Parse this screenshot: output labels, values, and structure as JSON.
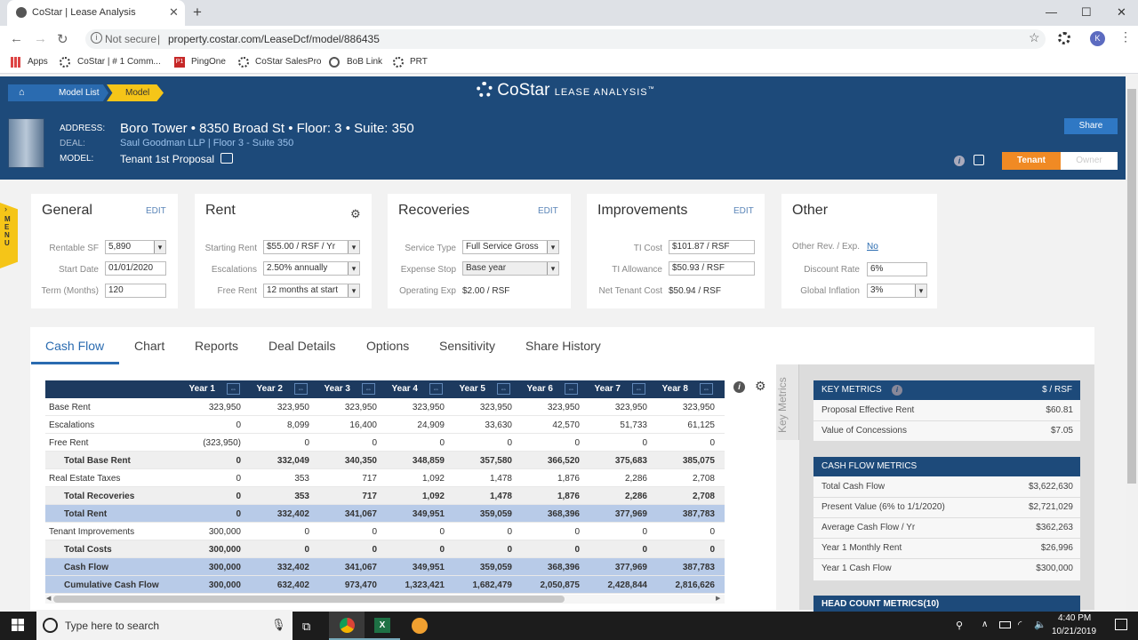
{
  "browser": {
    "tab_title": "CoStar | Lease Analysis",
    "tab_close": "✕",
    "new_tab": "+",
    "win_min": "—",
    "win_max": "☐",
    "win_close": "✕",
    "not_secure": "Not secure",
    "separator": "|",
    "url": "property.costar.com/LeaseDcf/model/886435",
    "profile_initial": "K",
    "bookmarks": [
      "Apps",
      "CoStar | # 1 Comm...",
      "PingOne",
      "CoStar SalesPro",
      "BoB Link",
      "PRT"
    ]
  },
  "app": {
    "breadcrumb": [
      "Model List",
      "Model"
    ],
    "logo_main": "CoStar",
    "logo_sub": "LEASE ANALYSIS",
    "logo_tm": "™",
    "address_label": "ADDRESS:",
    "address": "Boro Tower • 8350 Broad St • Floor: 3 • Suite: 350",
    "deal_label": "DEAL:",
    "deal": "Saul Goodman LLP | Floor 3 - Suite 350",
    "model_label": "MODEL:",
    "model": "Tenant 1st Proposal",
    "share": "Share",
    "tenant": "Tenant",
    "owner": "Owner"
  },
  "cards": {
    "general": {
      "title": "General",
      "edit": "EDIT",
      "rentable_sf_label": "Rentable SF",
      "rentable_sf": "5,890",
      "start_date_label": "Start Date",
      "start_date": "01/01/2020",
      "term_label": "Term (Months)",
      "term": "120"
    },
    "rent": {
      "title": "Rent",
      "starting_rent_label": "Starting Rent",
      "starting_rent": "$55.00 / RSF / Yr",
      "escalations_label": "Escalations",
      "escalations": "2.50% annually",
      "free_rent_label": "Free Rent",
      "free_rent": "12 months at start"
    },
    "recoveries": {
      "title": "Recoveries",
      "edit": "EDIT",
      "service_type_label": "Service Type",
      "service_type": "Full Service Gross",
      "expense_stop_label": "Expense Stop",
      "expense_stop": "Base year",
      "operating_exp_label": "Operating Exp",
      "operating_exp": "$2.00 / RSF"
    },
    "improvements": {
      "title": "Improvements",
      "edit": "EDIT",
      "ti_cost_label": "TI Cost",
      "ti_cost": "$101.87 / RSF",
      "ti_allowance_label": "TI Allowance",
      "ti_allowance": "$50.93 / RSF",
      "net_tenant_cost_label": "Net Tenant Cost",
      "net_tenant_cost": "$50.94 / RSF"
    },
    "other": {
      "title": "Other",
      "other_rev_label": "Other Rev. / Exp.",
      "other_rev": "No",
      "discount_rate_label": "Discount Rate",
      "discount_rate": "6%",
      "global_inflation_label": "Global Inflation",
      "global_inflation": "3%"
    }
  },
  "tabs": [
    "Cash Flow",
    "Chart",
    "Reports",
    "Deal Details",
    "Options",
    "Sensitivity",
    "Share History"
  ],
  "table": {
    "columns": [
      "Year 1",
      "Year 2",
      "Year 3",
      "Year 4",
      "Year 5",
      "Year 6",
      "Year 7",
      "Year 8"
    ],
    "rows": [
      {
        "label": "Base Rent",
        "values": [
          "323,950",
          "323,950",
          "323,950",
          "323,950",
          "323,950",
          "323,950",
          "323,950",
          "323,950"
        ],
        "style": "plain"
      },
      {
        "label": "Escalations",
        "values": [
          "0",
          "8,099",
          "16,400",
          "24,909",
          "33,630",
          "42,570",
          "51,733",
          "61,125"
        ],
        "style": "plain"
      },
      {
        "label": "Free Rent",
        "values": [
          "(323,950)",
          "0",
          "0",
          "0",
          "0",
          "0",
          "0",
          "0"
        ],
        "style": "plain"
      },
      {
        "label": "Total Base Rent",
        "values": [
          "0",
          "332,049",
          "340,350",
          "348,859",
          "357,580",
          "366,520",
          "375,683",
          "385,075"
        ],
        "style": "total"
      },
      {
        "label": "Real Estate Taxes",
        "values": [
          "0",
          "353",
          "717",
          "1,092",
          "1,478",
          "1,876",
          "2,286",
          "2,708"
        ],
        "style": "plain"
      },
      {
        "label": "Total Recoveries",
        "values": [
          "0",
          "353",
          "717",
          "1,092",
          "1,478",
          "1,876",
          "2,286",
          "2,708"
        ],
        "style": "total"
      },
      {
        "label": "Total Rent",
        "values": [
          "0",
          "332,402",
          "341,067",
          "349,951",
          "359,059",
          "368,396",
          "377,969",
          "387,783"
        ],
        "style": "blue"
      },
      {
        "label": "Tenant Improvements",
        "values": [
          "300,000",
          "0",
          "0",
          "0",
          "0",
          "0",
          "0",
          "0"
        ],
        "style": "plain"
      },
      {
        "label": "Total Costs",
        "values": [
          "300,000",
          "0",
          "0",
          "0",
          "0",
          "0",
          "0",
          "0"
        ],
        "style": "total"
      },
      {
        "label": "Cash Flow",
        "values": [
          "300,000",
          "332,402",
          "341,067",
          "349,951",
          "359,059",
          "368,396",
          "377,969",
          "387,783"
        ],
        "style": "blue"
      },
      {
        "label": "Cumulative Cash Flow",
        "values": [
          "300,000",
          "632,402",
          "973,470",
          "1,323,421",
          "1,682,479",
          "2,050,875",
          "2,428,844",
          "2,816,626"
        ],
        "style": "blue"
      }
    ]
  },
  "metrics": {
    "side_label": "Key Metrics",
    "key_title": "KEY METRICS",
    "key_unit": "$ / RSF",
    "key_rows": [
      {
        "label": "Proposal Effective Rent",
        "value": "$60.81"
      },
      {
        "label": "Value of Concessions",
        "value": "$7.05"
      }
    ],
    "cf_title": "CASH FLOW METRICS",
    "cf_rows": [
      {
        "label": "Total Cash Flow",
        "value": "$3,622,630"
      },
      {
        "label": "Present Value (6% to 1/1/2020)",
        "value": "$2,721,029"
      },
      {
        "label": "Average Cash Flow / Yr",
        "value": "$362,263"
      },
      {
        "label": "Year 1 Monthly Rent",
        "value": "$26,996"
      },
      {
        "label": "Year 1 Cash Flow",
        "value": "$300,000"
      }
    ],
    "hc_title": "HEAD COUNT METRICS(10)"
  },
  "taskbar": {
    "search_placeholder": "Type here to search",
    "time": "4:40 PM",
    "date": "10/21/2019"
  }
}
